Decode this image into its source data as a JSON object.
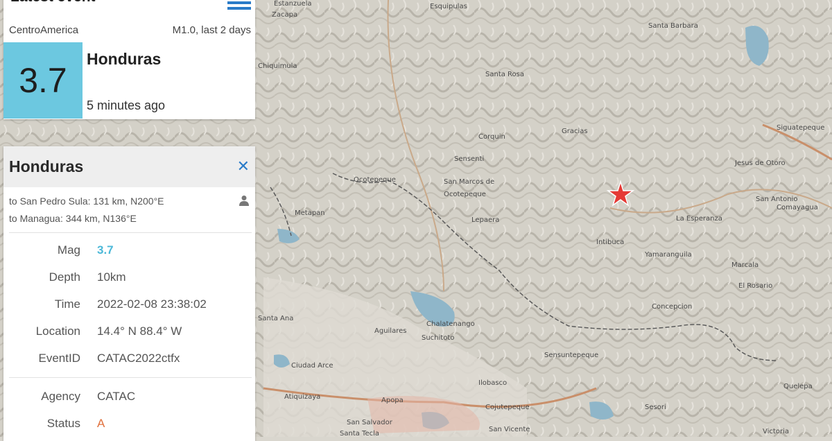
{
  "map": {
    "accent_star": "#e53935",
    "labels": [
      {
        "text": "Estanzuela"
      },
      {
        "text": "Zacapa"
      },
      {
        "text": "Esquipulas"
      },
      {
        "text": "Santa Barbara"
      },
      {
        "text": "Chiquimula"
      },
      {
        "text": "Santa Rosa"
      },
      {
        "text": "Ocotepeque"
      },
      {
        "text": "San Marcos de"
      },
      {
        "text": "Ocotepeque"
      },
      {
        "text": "Gracias"
      },
      {
        "text": "Sensenti"
      },
      {
        "text": "Corquin"
      },
      {
        "text": "Metapan"
      },
      {
        "text": "La Esperanza"
      },
      {
        "text": "Intibuca"
      },
      {
        "text": "Chalatenango"
      },
      {
        "text": "Santa Ana"
      },
      {
        "text": "Sensuntepeque"
      },
      {
        "text": "San Salvador"
      },
      {
        "text": "Santa Tecla"
      },
      {
        "text": "Cojutepeque"
      },
      {
        "text": "San Vicente"
      },
      {
        "text": "Ilobasco"
      },
      {
        "text": "Concepcion"
      },
      {
        "text": "Marcala"
      },
      {
        "text": "El Rosario"
      },
      {
        "text": "Siguatepeque"
      },
      {
        "text": "Jesus de Otoro"
      },
      {
        "text": "San Antonio"
      },
      {
        "text": "Comayagua"
      },
      {
        "text": "Apopa"
      },
      {
        "text": "Suchitoto"
      },
      {
        "text": "Lepaera"
      },
      {
        "text": "Yamaranguila"
      },
      {
        "text": "Sesori"
      },
      {
        "text": "Victoria"
      },
      {
        "text": "Aguilares"
      },
      {
        "text": "Ciudad Arce"
      },
      {
        "text": "Atiquizaya"
      },
      {
        "text": "Quelepa"
      }
    ]
  },
  "latest": {
    "title": "Latest event",
    "region": "CentroAmerica",
    "filter": "M1.0, last 2 days",
    "magnitude": "3.7",
    "place": "Honduras",
    "ago": "5 minutes ago",
    "mag_color": "#6cc8e0"
  },
  "detail": {
    "title": "Honduras",
    "close": "✕",
    "distances": [
      "to San Pedro Sula: 131 km, N200°E",
      "to Managua: 344 km, N136°E"
    ],
    "rows": [
      {
        "key": "Mag",
        "value": "3.7"
      },
      {
        "key": "Depth",
        "value": "10km"
      },
      {
        "key": "Time",
        "value": "2022-02-08 23:38:02"
      },
      {
        "key": "Location",
        "value": "14.4° N 88.4° W"
      },
      {
        "key": "EventID",
        "value": "CATAC2022ctfx"
      },
      {
        "key": "Agency",
        "value": "CATAC"
      },
      {
        "key": "Status",
        "value": "A"
      }
    ]
  }
}
